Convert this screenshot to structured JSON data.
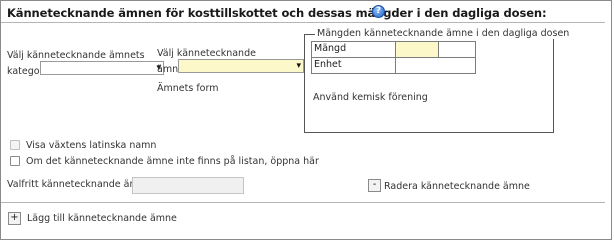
{
  "header": {
    "title": "Kännetecknande ämnen för kosttillskottet och dessas mängder i den dagliga dosen:",
    "help_glyph": "?"
  },
  "category": {
    "label_line1": "Välj kännetecknande ämnets",
    "label_line2": "kategori",
    "value": ""
  },
  "substance": {
    "label_line1": "Välj kännetecknande",
    "label_line2": "ämne",
    "value": "",
    "form_label": "Ämnets form"
  },
  "amount_box": {
    "legend": "Mängden kännetecknande ämne i den dagliga dosen",
    "rows": [
      {
        "label": "Mängd",
        "value": ""
      },
      {
        "label": "Enhet",
        "value": ""
      }
    ],
    "chemical_label": "Använd kemisk förening"
  },
  "options": {
    "latin_names": "Visa växtens latinska namn",
    "not_in_list": "Om det kännetecknande ämne inte finns på listan, öppna här"
  },
  "optional": {
    "label": "Valfritt kännetecknande ämne",
    "value": ""
  },
  "actions": {
    "remove_glyph": "-",
    "remove_label": "Radera kännetecknande ämne",
    "add_glyph": "+",
    "add_label": "Lägg till kännetecknande ämne"
  },
  "icons": {
    "dropdown": "▾"
  }
}
